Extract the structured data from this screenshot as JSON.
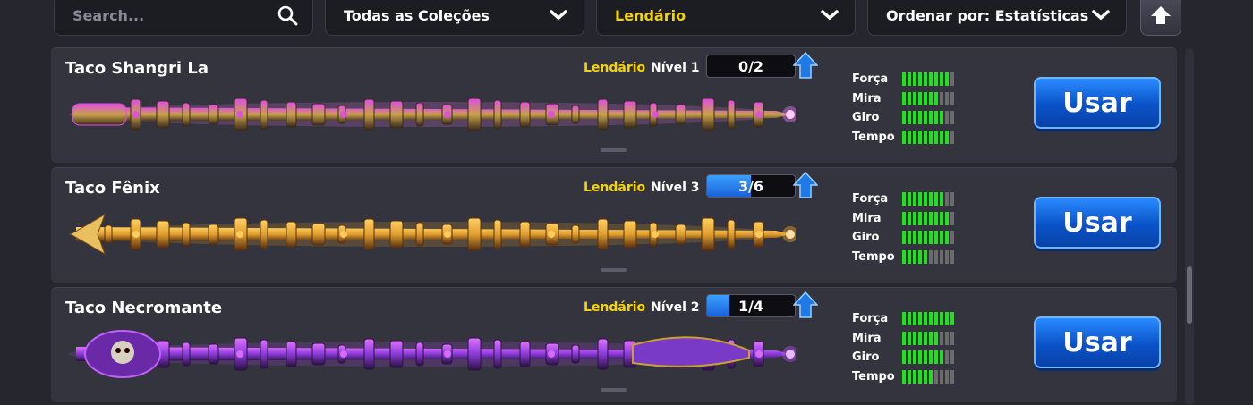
{
  "filters": {
    "search_placeholder": "Search...",
    "collection": "Todas as Coleções",
    "rarity": "Lendário",
    "sort": "Ordenar por: Estatísticas"
  },
  "stat_labels": [
    "Força",
    "Mira",
    "Giro",
    "Tempo"
  ],
  "use_label": "Usar",
  "colors": {
    "legendary": "#f5d400",
    "stat_on": "#22e01f",
    "stat_off": "#6b6b6b",
    "button": "#0a52c8"
  },
  "cues": [
    {
      "name": "Taco Shangri La",
      "rarity": "Lendário",
      "level": "Nível 1",
      "progress_text": "0/2",
      "progress_fraction": 0,
      "stats": {
        "forca": 9,
        "mira": 7,
        "giro": 8,
        "tempo": 9
      },
      "theme": "shangri"
    },
    {
      "name": "Taco Fênix",
      "rarity": "Lendário",
      "level": "Nível 3",
      "progress_text": "3/6",
      "progress_fraction": 0.5,
      "stats": {
        "forca": 8,
        "mira": 9,
        "giro": 9,
        "tempo": 5
      },
      "theme": "phoenix"
    },
    {
      "name": "Taco Necromante",
      "rarity": "Lendário",
      "level": "Nível 2",
      "progress_text": "1/4",
      "progress_fraction": 0.25,
      "stats": {
        "forca": 10,
        "mira": 7,
        "giro": 8,
        "tempo": 6
      },
      "theme": "necro"
    }
  ]
}
